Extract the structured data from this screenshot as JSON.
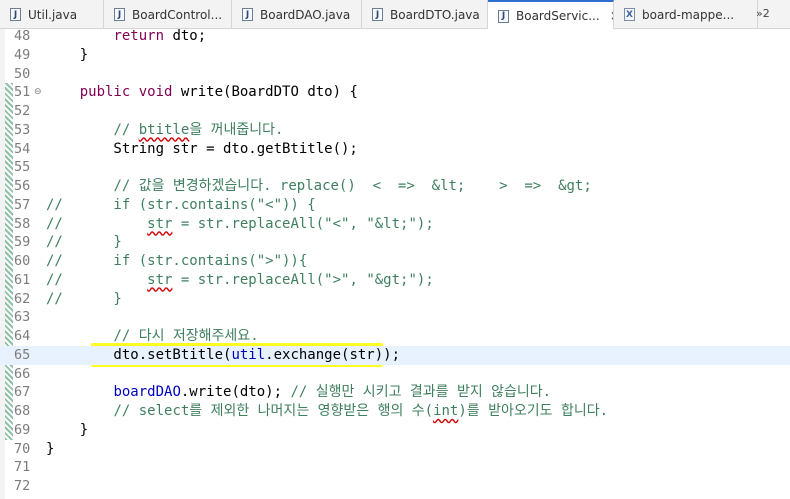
{
  "tabs": [
    {
      "label": "Util.java",
      "icon": "java-file-icon"
    },
    {
      "label": "BoardControl...",
      "icon": "java-file-icon"
    },
    {
      "label": "BoardDAO.java",
      "icon": "java-file-icon"
    },
    {
      "label": "BoardDTO.java",
      "icon": "java-file-icon"
    },
    {
      "label": "BoardServic...",
      "icon": "java-file-icon",
      "active": true,
      "close": "×"
    },
    {
      "label": "board-mappe...",
      "icon": "xml-file-icon"
    }
  ],
  "tab_overflow": "»2",
  "editor": {
    "lines": [
      {
        "n": "48",
        "s": [
          {
            "c": "        "
          },
          {
            "c": "return",
            "k": "kw"
          },
          {
            "c": " dto;"
          }
        ]
      },
      {
        "n": "49",
        "s": [
          {
            "c": "    }"
          }
        ]
      },
      {
        "n": "50",
        "s": []
      },
      {
        "n": "51",
        "fold": "⊖",
        "s": [
          {
            "c": "    "
          },
          {
            "c": "public",
            "k": "kw"
          },
          {
            "c": " "
          },
          {
            "c": "void",
            "k": "kw"
          },
          {
            "c": " write(BoardDTO dto) {"
          }
        ]
      },
      {
        "n": "52",
        "s": []
      },
      {
        "n": "53",
        "s": [
          {
            "c": "        "
          },
          {
            "c": "// ",
            "k": "cm"
          },
          {
            "c": "btitle",
            "k": "cm sq"
          },
          {
            "c": "을 꺼내줍니다.",
            "k": "cm"
          }
        ]
      },
      {
        "n": "54",
        "s": [
          {
            "c": "        String str = dto.getBtitle();"
          }
        ]
      },
      {
        "n": "55",
        "s": []
      },
      {
        "n": "56",
        "s": [
          {
            "c": "        "
          },
          {
            "c": "// 값을 변경하겠습니다. replace()  <  =>  &lt;    >  =>  &gt;",
            "k": "cm"
          }
        ]
      },
      {
        "n": "57",
        "s": [
          {
            "c": "//      if (str.contains(\"<\")) {",
            "k": "cm"
          }
        ]
      },
      {
        "n": "58",
        "s": [
          {
            "c": "//          ",
            "k": "cm"
          },
          {
            "c": "str",
            "k": "cm sq"
          },
          {
            "c": " = str.replaceAll(\"<\", \"&lt;\");",
            "k": "cm"
          }
        ]
      },
      {
        "n": "59",
        "s": [
          {
            "c": "//      }",
            "k": "cm"
          }
        ]
      },
      {
        "n": "60",
        "s": [
          {
            "c": "//      if (str.contains(\">\")){",
            "k": "cm"
          }
        ]
      },
      {
        "n": "61",
        "s": [
          {
            "c": "//          ",
            "k": "cm"
          },
          {
            "c": "str",
            "k": "cm sq"
          },
          {
            "c": " = str.replaceAll(\">\", \"&gt;\");",
            "k": "cm"
          }
        ]
      },
      {
        "n": "62",
        "s": [
          {
            "c": "//      }",
            "k": "cm"
          }
        ]
      },
      {
        "n": "63",
        "s": []
      },
      {
        "n": "64",
        "s": [
          {
            "c": "        "
          },
          {
            "c": "// 다시 저장해주세요.",
            "k": "cm"
          }
        ]
      },
      {
        "n": "65",
        "hl": true,
        "s": [
          {
            "c": "        dto.setBtitle("
          },
          {
            "c": "util",
            "k": "fld"
          },
          {
            "c": ".exchange(str));"
          }
        ]
      },
      {
        "n": "66",
        "s": []
      },
      {
        "n": "67",
        "s": [
          {
            "c": "        "
          },
          {
            "c": "boardDAO",
            "k": "fld"
          },
          {
            "c": ".write(dto); "
          },
          {
            "c": "// 실행만 시키고 결과를 받지 않습니다.",
            "k": "cm"
          }
        ]
      },
      {
        "n": "68",
        "s": [
          {
            "c": "        "
          },
          {
            "c": "// select를 제외한 나머지는 영향받은 행의 수(",
            "k": "cm"
          },
          {
            "c": "int",
            "k": "cm sq"
          },
          {
            "c": ")를 받아오기도 합니다.",
            "k": "cm"
          }
        ]
      },
      {
        "n": "69",
        "s": [
          {
            "c": "    }"
          }
        ]
      },
      {
        "n": "70",
        "s": [
          {
            "c": "}"
          }
        ]
      },
      {
        "n": "71",
        "s": []
      },
      {
        "n": "72",
        "s": []
      }
    ]
  },
  "colors": {
    "keyword": "#7f0055",
    "comment": "#3f7f5f",
    "field": "#0000c0",
    "current_line": "#e8f2fe",
    "marker_highlight": "#ffff22",
    "active_tab_accent": "#2f6fd0"
  }
}
